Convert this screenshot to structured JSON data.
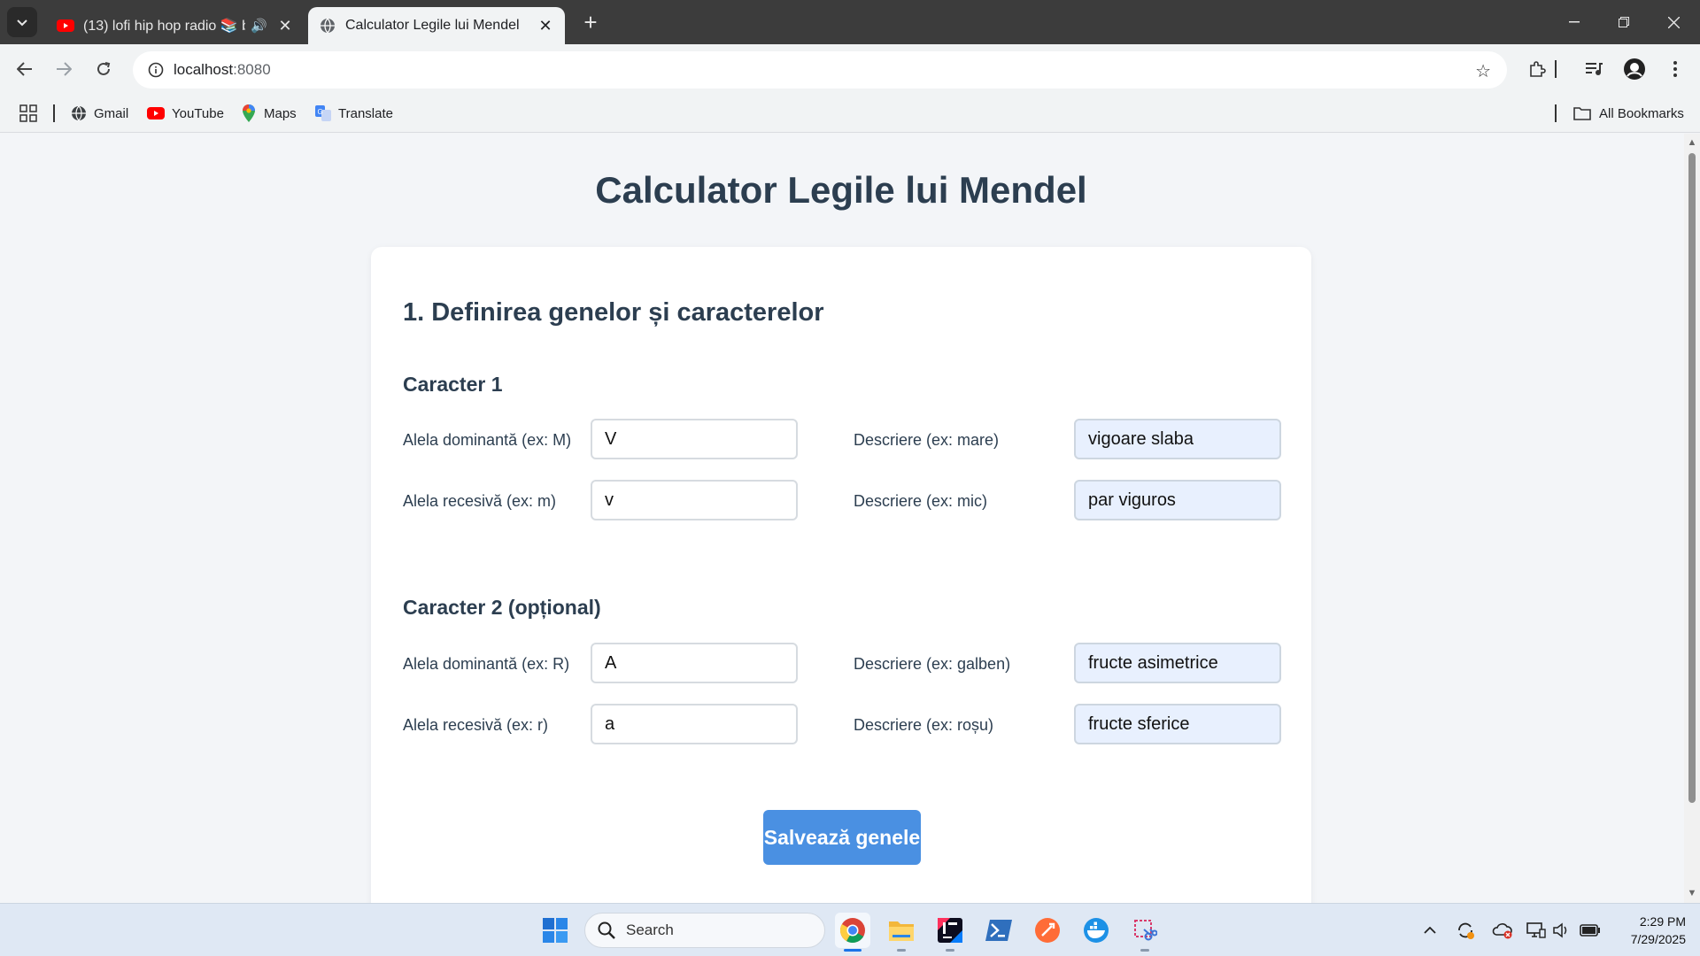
{
  "browser": {
    "tabs": [
      {
        "title": "(13) lofi hip hop radio 📚 b",
        "favicon": "youtube-icon",
        "audio": true,
        "active": false
      },
      {
        "title": "Calculator Legile lui Mendel",
        "favicon": "globe-icon",
        "active": true
      }
    ],
    "url": {
      "host": "localhost",
      "port": ":8080"
    },
    "bookmarks": [
      {
        "label": "Gmail",
        "icon": "gmail-icon"
      },
      {
        "label": "YouTube",
        "icon": "youtube-icon"
      },
      {
        "label": "Maps",
        "icon": "maps-icon"
      },
      {
        "label": "Translate",
        "icon": "translate-icon"
      }
    ],
    "all_bookmarks_label": "All Bookmarks"
  },
  "page": {
    "title": "Calculator Legile lui Mendel",
    "section_title": "1. Definirea genelor și caracterelor",
    "character1": {
      "title": "Caracter 1",
      "dominant_label": "Alela dominantă (ex: M)",
      "dominant_value": "V",
      "dominant_desc_label": "Descriere (ex: mare)",
      "dominant_desc_value": "vigoare slaba",
      "recessive_label": "Alela recesivă (ex: m)",
      "recessive_value": "v",
      "recessive_desc_label": "Descriere (ex: mic)",
      "recessive_desc_value": "par viguros"
    },
    "character2": {
      "title": "Caracter 2 (opțional)",
      "dominant_label": "Alela dominantă (ex: R)",
      "dominant_value": "A",
      "dominant_desc_label": "Descriere (ex: galben)",
      "dominant_desc_value": "fructe asimetrice",
      "recessive_label": "Alela recesivă (ex: r)",
      "recessive_value": "a",
      "recessive_desc_label": "Descriere (ex: roșu)",
      "recessive_desc_value": "fructe sferice"
    },
    "save_button": "Salvează genele"
  },
  "taskbar": {
    "search_placeholder": "Search",
    "time": "2:29 PM",
    "date": "7/29/2025",
    "colors": {
      "accent": "#4a90e2",
      "heading": "#2c3e50"
    }
  }
}
